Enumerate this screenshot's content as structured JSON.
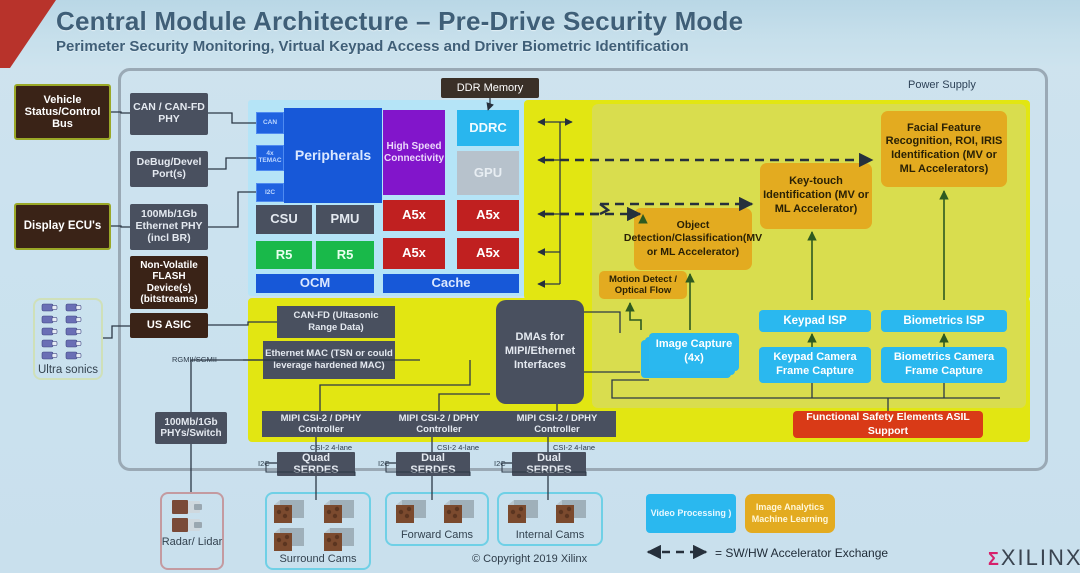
{
  "header": {
    "title": "Central Module Architecture – Pre-Drive Security Mode",
    "subtitle": "Perimeter Security Monitoring, Virtual Keypad Access and Driver Biometric Identification"
  },
  "labels": {
    "power_supply": "Power Supply",
    "ddr_memory": "DDR Memory",
    "copyright": "© Copyright 2019 Xilinx",
    "xilinx": "XILINX",
    "rgmii": "RGMII/SGMII",
    "legend_arrow_text": "= SW/HW Accelerator Exchange"
  },
  "external_left": [
    {
      "id": "vehicle-status-control-bus",
      "label": "Vehicle Status/Control Bus"
    },
    {
      "id": "display-ecus",
      "label": "Display ECU's"
    },
    {
      "id": "ultra-sonics",
      "label": "Ultra sonics"
    }
  ],
  "phy_column": [
    {
      "id": "can-can-fd-phy",
      "label": "CAN / CAN-FD PHY"
    },
    {
      "id": "debug-devel-ports",
      "label": "DeBug/Devel Port(s)"
    },
    {
      "id": "ethernet-phy",
      "label": "100Mb/1Gb Ethernet PHY (incl BR)"
    },
    {
      "id": "non-volatile-flash",
      "label": "Non-Volatile FLASH Device(s) (bitstreams)"
    },
    {
      "id": "us-asic",
      "label": "US ASIC"
    },
    {
      "id": "phys-switch",
      "label": "100Mb/1Gb PHYs/Switch"
    }
  ],
  "soc": {
    "peripherals": "Peripherals",
    "peripheral_tabs": [
      "CAN",
      "4x TEMAC",
      "I2C"
    ],
    "csu": "CSU",
    "pmu": "PMU",
    "r5_a": "R5",
    "r5_b": "R5",
    "ocm": "OCM",
    "high_speed_connectivity": "High Speed Connectivity",
    "a5x": [
      "A5x",
      "A5x",
      "A5x",
      "A5x"
    ],
    "ddrc": "DDRC",
    "gpu": "GPU",
    "cache": "Cache"
  },
  "fabric": {
    "can_fd": "CAN-FD (Ultasonic Range Data)",
    "ethernet_mac": "Ethernet MAC (TSN or could leverage hardened MAC)",
    "dmas": "DMAs for MIPI/Ethernet Interfaces",
    "mipi_controllers": [
      "MIPI CSI-2 / DPHY Controller",
      "MIPI CSI-2 / DPHY Controller",
      "MIPI CSI-2 / DPHY Controller"
    ],
    "functional_safety": "Functional Safety Elements ASIL Support"
  },
  "accelerators": [
    {
      "id": "facial-feature-recognition",
      "label": "Facial Feature Recognition, ROI, IRIS Identification (MV or ML Accelerators)"
    },
    {
      "id": "key-touch-identification",
      "label": "Key-touch Identification (MV or ML Accelerator)"
    },
    {
      "id": "object-detection-classification",
      "label": "Object Detection/Classification(MV or ML Accelerator)"
    },
    {
      "id": "motion-detect-optical-flow",
      "label": "Motion Detect / Optical Flow"
    }
  ],
  "video_blocks": [
    {
      "id": "image-capture",
      "label": "Image Capture (4x)"
    },
    {
      "id": "keypad-isp",
      "label": "Keypad ISP"
    },
    {
      "id": "biometrics-isp",
      "label": "Biometrics ISP"
    },
    {
      "id": "keypad-camera-frame-capture",
      "label": "Keypad Camera Frame Capture"
    },
    {
      "id": "biometrics-camera-frame-capture",
      "label": "Biometrics Camera Frame Capture"
    }
  ],
  "serdes": [
    {
      "id": "quad-serdes",
      "label": "Quad SERDES",
      "link": "CSI-2 4-lane",
      "i2c": "I2C"
    },
    {
      "id": "dual-serdes-1",
      "label": "Dual SERDES",
      "link": "CSI-2 4-lane",
      "i2c": "I2C"
    },
    {
      "id": "dual-serdes-2",
      "label": "Dual SERDES",
      "link": "CSI-2 4-lane",
      "i2c": "I2C"
    }
  ],
  "sensors": [
    {
      "id": "radar-lidar",
      "label": "Radar/ Lidar"
    },
    {
      "id": "surround-cams",
      "label": "Surround Cams"
    },
    {
      "id": "forward-cams",
      "label": "Forward Cams"
    },
    {
      "id": "internal-cams",
      "label": "Internal Cams"
    }
  ],
  "legend": [
    {
      "id": "video-processing",
      "label": "Video Processing )",
      "color": "#2ab8ef"
    },
    {
      "id": "image-analytics-machine-learning",
      "label": "Image Analytics Machine Learning",
      "color": "#e3ab20"
    }
  ],
  "colors": {
    "accent_red": "#b8332b",
    "title_blue": "#3f5f78",
    "fabric_yellow": "#e2e612",
    "accel_yellow": "#d9dd4e",
    "soc_blue": "#1758d8",
    "cyan": "#2ab8ef",
    "gold": "#e3ab20"
  }
}
